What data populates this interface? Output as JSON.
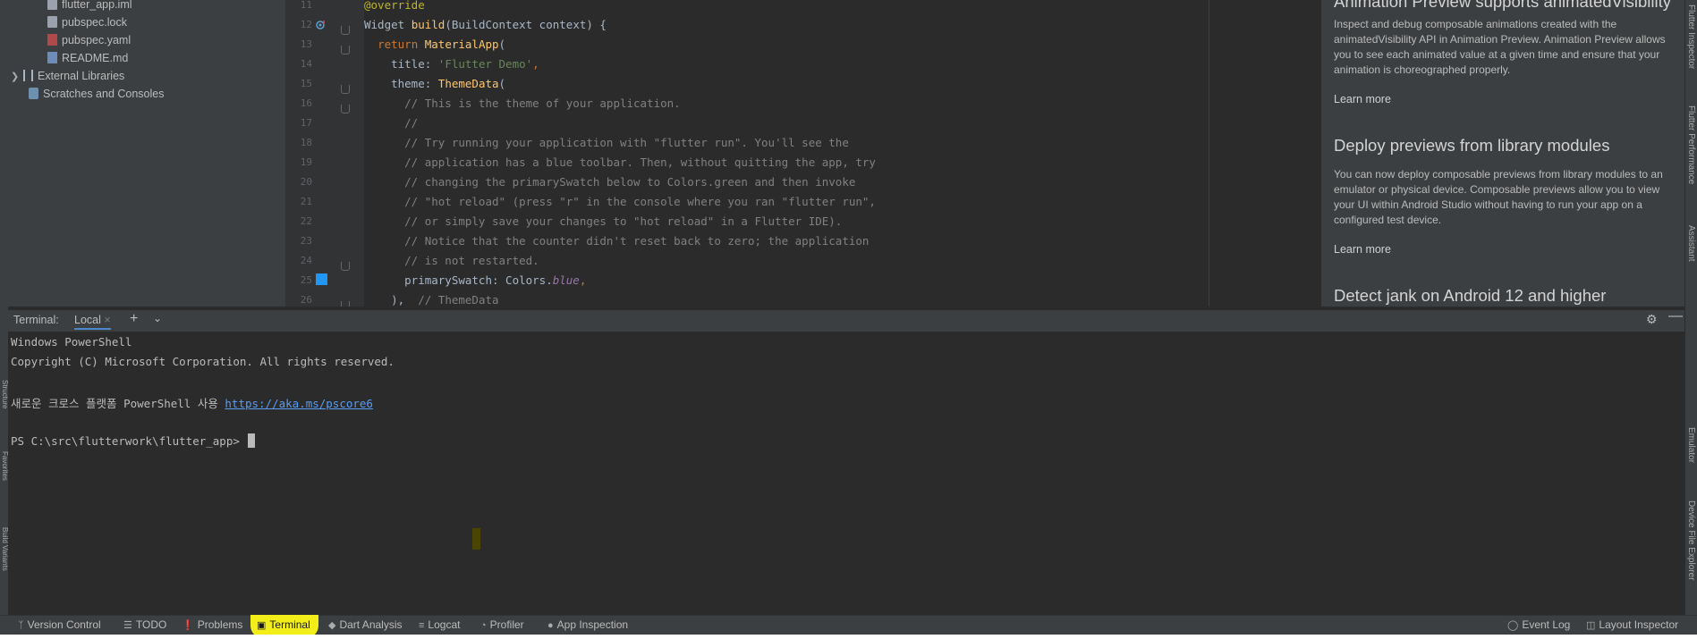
{
  "project": {
    "items": [
      {
        "label": "flutter_app.iml",
        "icon": "iml-file-icon"
      },
      {
        "label": "pubspec.lock",
        "icon": "lock-file-icon"
      },
      {
        "label": "pubspec.yaml",
        "icon": "yaml-file-icon"
      },
      {
        "label": "README.md",
        "icon": "markdown-file-icon"
      },
      {
        "label": "External Libraries",
        "icon": "library-icon"
      },
      {
        "label": "Scratches and Consoles",
        "icon": "scratch-icon"
      }
    ]
  },
  "editor": {
    "lines": [
      {
        "num": "11",
        "parts": [
          {
            "c": "ann",
            "t": "@override"
          }
        ]
      },
      {
        "num": "12",
        "parts": [
          {
            "c": "",
            "t": "Widget "
          },
          {
            "c": "fn",
            "t": "build"
          },
          {
            "c": "",
            "t": "(BuildContext context) {"
          }
        ]
      },
      {
        "num": "13",
        "parts": [
          {
            "c": "",
            "t": "  "
          },
          {
            "c": "kw",
            "t": "return "
          },
          {
            "c": "fn",
            "t": "MaterialApp"
          },
          {
            "c": "",
            "t": "("
          }
        ]
      },
      {
        "num": "14",
        "parts": [
          {
            "c": "",
            "t": "    title: "
          },
          {
            "c": "str",
            "t": "'Flutter Demo'"
          },
          {
            "c": "kw",
            "t": ","
          }
        ]
      },
      {
        "num": "15",
        "parts": [
          {
            "c": "",
            "t": "    theme: "
          },
          {
            "c": "fn",
            "t": "ThemeData"
          },
          {
            "c": "",
            "t": "("
          }
        ]
      },
      {
        "num": "16",
        "parts": [
          {
            "c": "cm",
            "t": "      // This is the theme of your application."
          }
        ]
      },
      {
        "num": "17",
        "parts": [
          {
            "c": "cm",
            "t": "      //"
          }
        ]
      },
      {
        "num": "18",
        "parts": [
          {
            "c": "cm",
            "t": "      // Try running your application with \"flutter run\". You'll see the"
          }
        ]
      },
      {
        "num": "19",
        "parts": [
          {
            "c": "cm",
            "t": "      // application has a blue toolbar. Then, without quitting the app, try"
          }
        ]
      },
      {
        "num": "20",
        "parts": [
          {
            "c": "cm",
            "t": "      // changing the primarySwatch below to Colors.green and then invoke"
          }
        ]
      },
      {
        "num": "21",
        "parts": [
          {
            "c": "cm",
            "t": "      // \"hot reload\" (press \"r\" in the console where you ran \"flutter run\","
          }
        ]
      },
      {
        "num": "22",
        "parts": [
          {
            "c": "cm",
            "t": "      // or simply save your changes to \"hot reload\" in a Flutter IDE)."
          }
        ]
      },
      {
        "num": "23",
        "parts": [
          {
            "c": "cm",
            "t": "      // Notice that the counter didn't reset back to zero; the application"
          }
        ]
      },
      {
        "num": "24",
        "parts": [
          {
            "c": "cm",
            "t": "      // is not restarted."
          }
        ]
      },
      {
        "num": "25",
        "parts": [
          {
            "c": "",
            "t": "      primarySwatch: Colors."
          },
          {
            "c": "ital",
            "t": "blue"
          },
          {
            "c": "kw",
            "t": ","
          }
        ]
      },
      {
        "num": "26",
        "parts": [
          {
            "c": "",
            "t": "    ),  "
          },
          {
            "c": "cm",
            "t": "// ThemeData"
          }
        ]
      }
    ]
  },
  "assistant": {
    "partial_heading": "Animation Preview supports animatedVisibility",
    "para1": "Inspect and debug composable animations created with the animatedVisibility API in Animation Preview. Animation Preview allows you to see each animated value at a given time and ensure that your animation is choreographed properly.",
    "learn_more": "Learn more",
    "heading2": "Deploy previews from library modules",
    "para2": "You can now deploy composable previews from library modules to an emulator or physical device. Composable previews allow you to view your UI within Android Studio without having to run your app on a configured test device.",
    "heading3": "Detect jank on Android 12 and higher"
  },
  "right_strip": {
    "labels": [
      "Flutter Inspector",
      "Flutter Performance",
      "Assistant",
      "Emulator",
      "Device File Explorer"
    ]
  },
  "left_strip": {
    "labels": [
      "Structure",
      "Favorites",
      "Build Variants"
    ]
  },
  "terminal": {
    "title": "Terminal:",
    "tab": "Local",
    "lines": [
      "Windows PowerShell",
      "Copyright (C) Microsoft Corporation. All rights reserved.",
      "",
      "새로운 크로스 플랫폼 PowerShell 사용 ",
      "",
      "PS C:\\src\\flutterwork\\flutter_app> "
    ],
    "link": "https://aka.ms/pscore6"
  },
  "bottom_bar": {
    "left": [
      {
        "label": "Version Control",
        "icon": "version-control-icon"
      },
      {
        "label": "TODO",
        "icon": "todo-icon"
      },
      {
        "label": "Problems",
        "icon": "problems-icon"
      },
      {
        "label": "Terminal",
        "icon": "terminal-icon"
      },
      {
        "label": "Dart Analysis",
        "icon": "dart-analysis-icon"
      },
      {
        "label": "Logcat",
        "icon": "logcat-icon"
      },
      {
        "label": "Profiler",
        "icon": "profiler-icon"
      },
      {
        "label": "App Inspection",
        "icon": "app-inspection-icon"
      }
    ],
    "right": [
      {
        "label": "Event Log",
        "icon": "event-log-icon"
      },
      {
        "label": "Layout Inspector",
        "icon": "layout-inspector-icon"
      }
    ]
  },
  "colors": {
    "highlight": "#f3ee1a",
    "link": "#589df6",
    "editor_bg": "#2b2b2b",
    "panel_bg": "#3c3f41"
  }
}
